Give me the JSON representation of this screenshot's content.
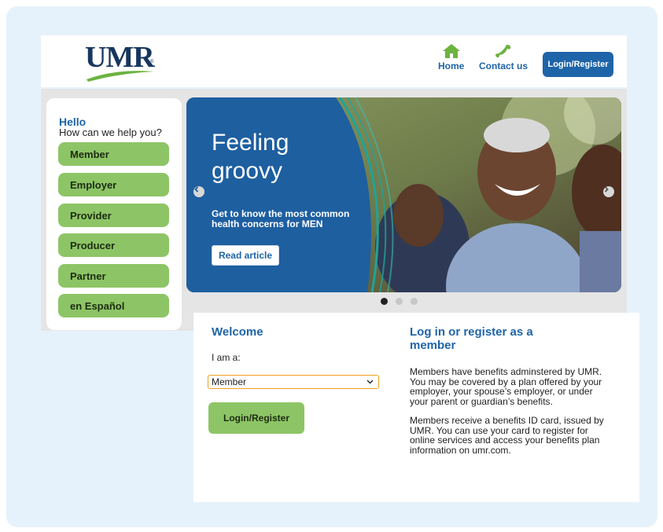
{
  "header": {
    "logo_text": "UMR",
    "logo_tm": "®",
    "nav": {
      "home": {
        "label": "Home",
        "icon": "home-icon"
      },
      "contact": {
        "label": "Contact us",
        "icon": "phone-icon"
      }
    },
    "login_button": "Login/Register"
  },
  "left_panel": {
    "greeting": "Hello",
    "question": "How can we help you?",
    "buttons": [
      "Member",
      "Employer",
      "Provider",
      "Producer",
      "Partner",
      "en Español"
    ]
  },
  "banner": {
    "headline": "Feeling groovy",
    "subtext": "Get to know the most common health concerns for MEN",
    "cta": "Read article",
    "slide_count": 3,
    "active_slide": 1
  },
  "welcome": {
    "title": "Welcome",
    "iam_label": "I am a:",
    "select_value": "Member",
    "login_button": "Login/Register"
  },
  "member_info": {
    "title": "Log in or register as a member",
    "paragraph1": "Members have benefits adminstered by UMR. You may be covered by a plan offered by your employer, your spouse’s employer, or under your parent or guardian’s benefits.",
    "paragraph2": "Members receive a benefits ID card, issued by UMR. You can use your card to register for online services and access your benefits plan information on umr.com."
  },
  "colors": {
    "brand_blue": "#1e64a8",
    "navy": "#17365d",
    "green": "#8dc566",
    "frame_bg": "#e6f2fb",
    "focus_orange": "#f0a020"
  }
}
